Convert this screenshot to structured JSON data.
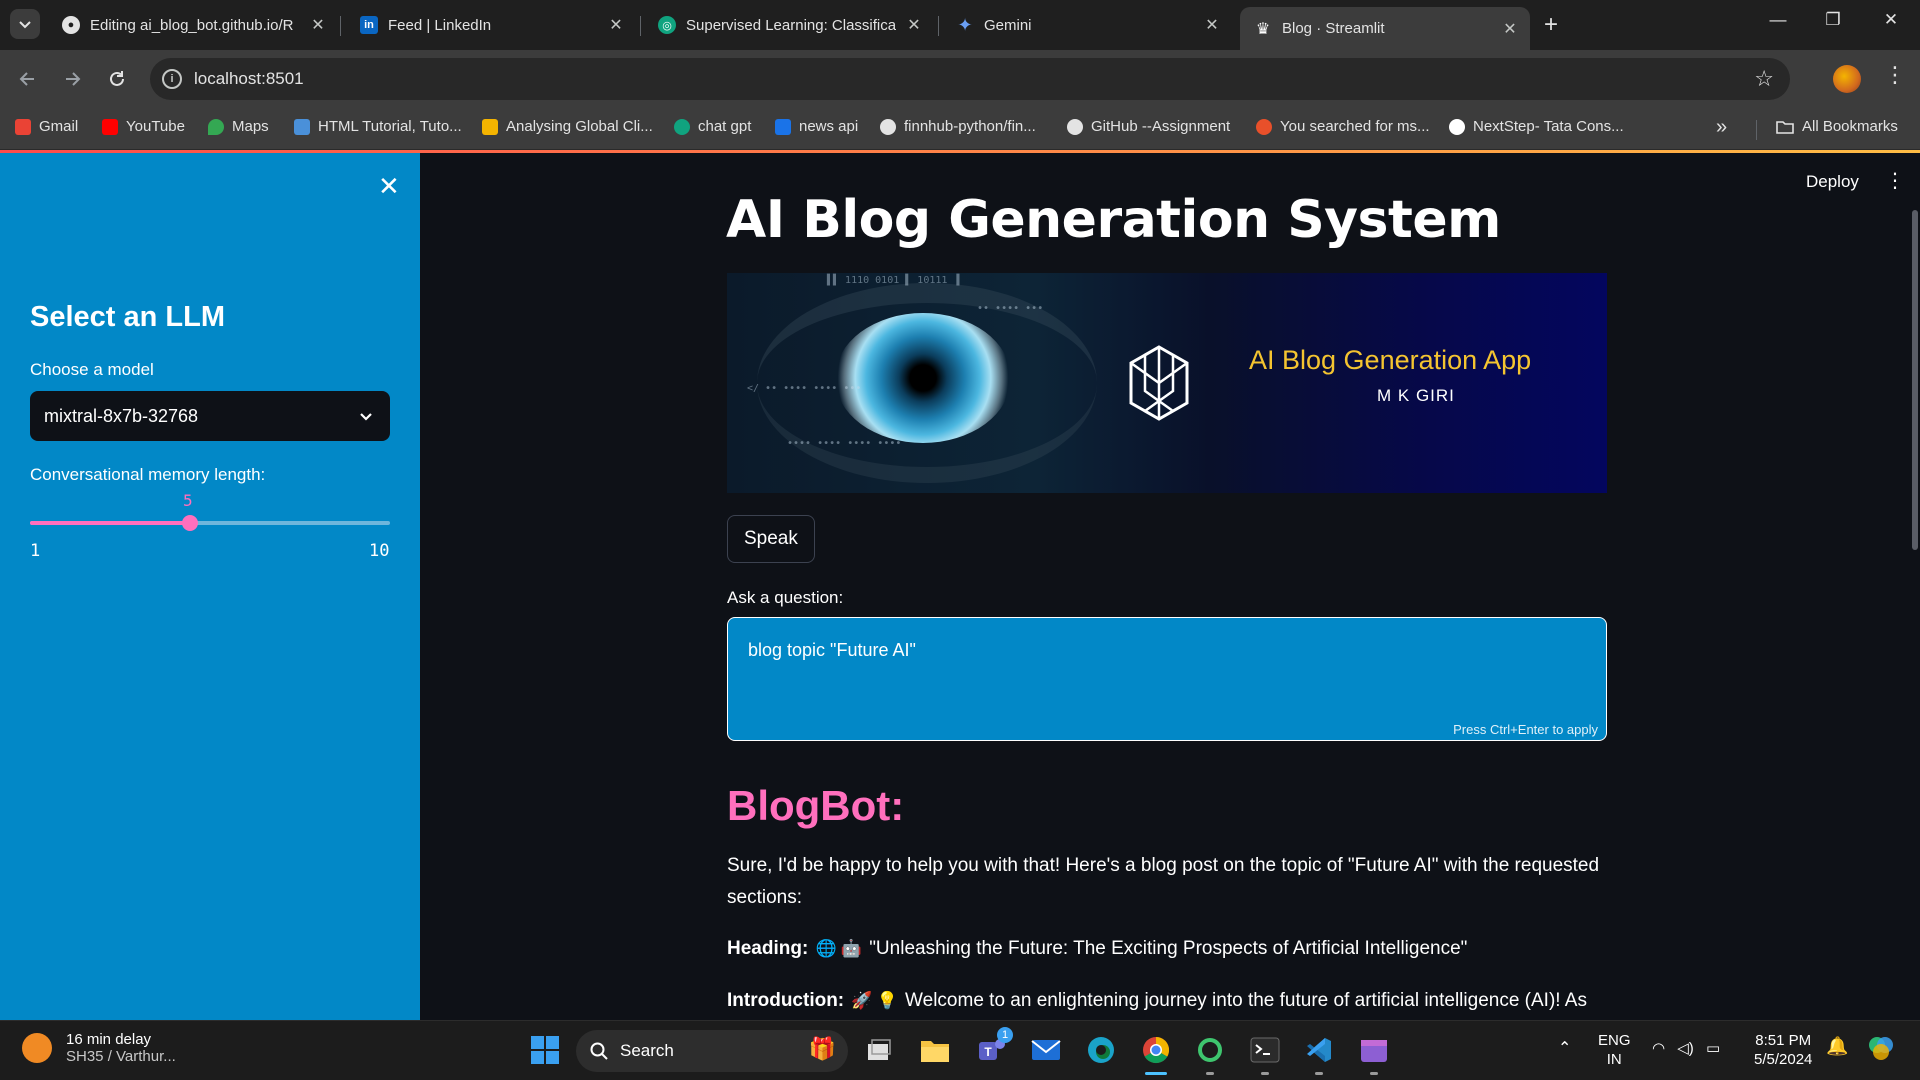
{
  "browser": {
    "tabs": [
      {
        "title": "Editing ai_blog_bot.github.io/R",
        "icon": "github-icon",
        "active": false
      },
      {
        "title": "Feed | LinkedIn",
        "icon": "linkedin-icon",
        "active": false
      },
      {
        "title": "Supervised Learning: Classificati",
        "icon": "openai-icon",
        "active": false
      },
      {
        "title": "Gemini",
        "icon": "gemini-icon",
        "active": false
      },
      {
        "title": "Blog · Streamlit",
        "icon": "streamlit-icon",
        "active": true
      }
    ],
    "url": "localhost:8501",
    "bookmarks": [
      {
        "label": "Gmail",
        "color": "#ea4335"
      },
      {
        "label": "YouTube",
        "color": "#ff0000"
      },
      {
        "label": "Maps",
        "color": "#34a853"
      },
      {
        "label": "HTML Tutorial, Tuto...",
        "color": "#4a90d9"
      },
      {
        "label": "Analysing Global Cli...",
        "color": "#f4b400"
      },
      {
        "label": "chat gpt",
        "color": "#10a37f"
      },
      {
        "label": "news api",
        "color": "#1a73e8"
      },
      {
        "label": "finnhub-python/fin...",
        "color": "#e3e3e3"
      },
      {
        "label": "GitHub --Assignment",
        "color": "#e3e3e3"
      },
      {
        "label": "You searched for ms...",
        "color": "#e8502a"
      },
      {
        "label": "NextStep- Tata Cons...",
        "color": "#ffffff"
      }
    ],
    "all_bookmarks": "All Bookmarks"
  },
  "sidebar": {
    "title": "Select an LLM",
    "model_label": "Choose a model",
    "model_value": "mixtral-8x7b-32768",
    "memory_label": "Conversational memory length:",
    "memory_value": "5",
    "memory_min": "1",
    "memory_max": "10",
    "memory_fraction": 0.444
  },
  "header": {
    "deploy": "Deploy"
  },
  "main": {
    "title": "AI Blog Generation System",
    "banner_title": "AI Blog Generation App",
    "banner_author": "M K GIRI",
    "speak_button": "Speak",
    "ask_label": "Ask a question:",
    "ask_value": "blog topic \"Future AI\"",
    "ask_hint": "Press Ctrl+Enter to apply",
    "bot_name": "BlogBot:",
    "response_intro": "Sure, I'd be happy to help you with that! Here's a blog post on the topic of \"Future AI\" with the requested sections:",
    "heading_label": "Heading:",
    "heading_text": "\"Unleashing the Future: The Exciting Prospects of Artificial Intelligence\"",
    "intro_label": "Introduction:",
    "intro_text": "Welcome to an enlightening journey into the future of artificial intelligence (AI)! As"
  },
  "taskbar": {
    "weather_line1": "16 min delay",
    "weather_line2": "SH35 / Varthur...",
    "search_label": "Search",
    "lang_line1": "ENG",
    "lang_line2": "IN",
    "time": "8:51 PM",
    "date": "5/5/2024",
    "teams_badge": "1"
  }
}
